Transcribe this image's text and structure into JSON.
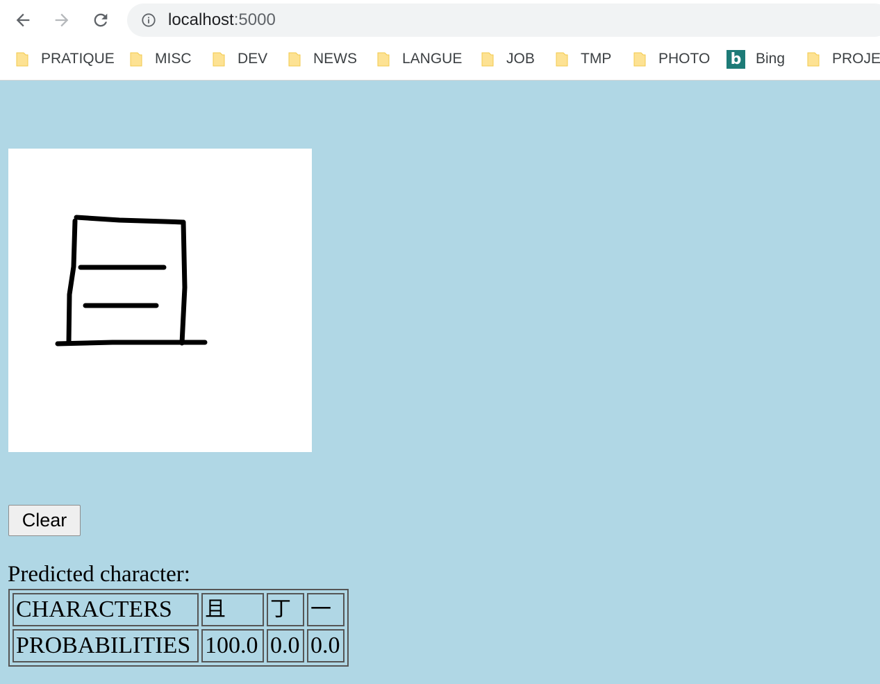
{
  "browser": {
    "url_host": "localhost",
    "url_port": ":5000",
    "bookmarks": [
      {
        "label": "PRATIQUE",
        "icon": "folder-icon"
      },
      {
        "label": "MISC",
        "icon": "folder-icon"
      },
      {
        "label": "DEV",
        "icon": "folder-icon"
      },
      {
        "label": "NEWS",
        "icon": "folder-icon"
      },
      {
        "label": "LANGUE",
        "icon": "folder-icon"
      },
      {
        "label": "JOB",
        "icon": "folder-icon"
      },
      {
        "label": "TMP",
        "icon": "folder-icon"
      },
      {
        "label": "PHOTO",
        "icon": "folder-icon"
      },
      {
        "label": "Bing",
        "icon": "bing-icon"
      },
      {
        "label": "PROJEC",
        "icon": "folder-icon"
      }
    ]
  },
  "page": {
    "clear_label": "Clear",
    "predicted_label": "Predicted character:",
    "table": {
      "row1_header": "CHARACTERS",
      "row2_header": "PROBABILITIES",
      "characters": [
        "且",
        "丁",
        "一"
      ],
      "probabilities": [
        "100.0",
        "0.0",
        "0.0"
      ]
    }
  },
  "colors": {
    "page_background": "#b0d7e5",
    "folder_icon": "#fde293",
    "bing_brand": "#1d7b77"
  }
}
